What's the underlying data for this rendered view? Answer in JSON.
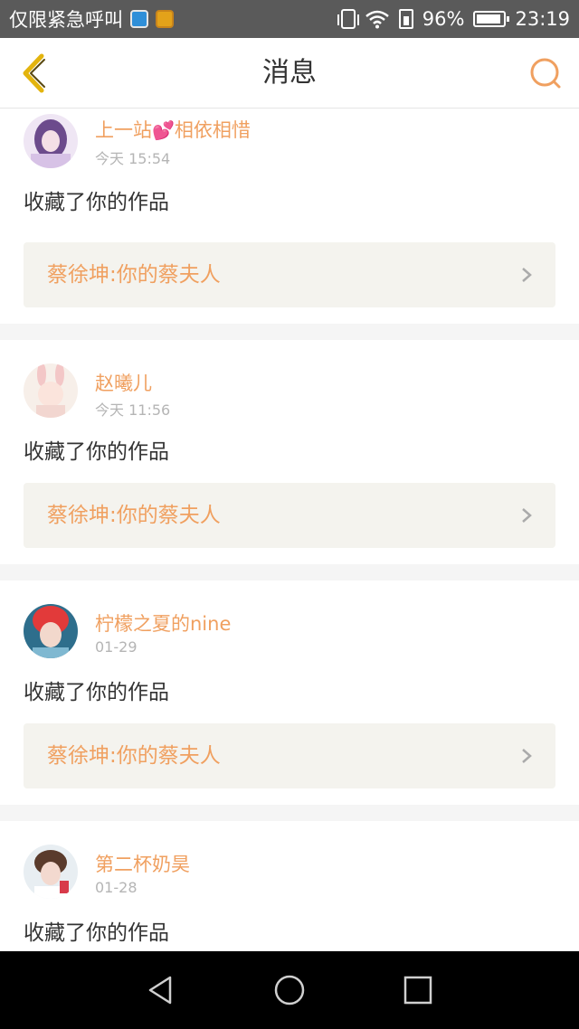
{
  "status_bar": {
    "carrier_text": "仅限紧急呼叫",
    "battery": "96%",
    "time": "23:19"
  },
  "header": {
    "title": "消息"
  },
  "messages": [
    {
      "username": "上一站",
      "username_suffix": "相依相惜",
      "time": "今天 15:54",
      "action": "收藏了你的作品",
      "work_title": "蔡徐坤:你的蔡夫人"
    },
    {
      "username": "赵曦儿",
      "time": "今天 11:56",
      "action": "收藏了你的作品",
      "work_title": "蔡徐坤:你的蔡夫人"
    },
    {
      "username": "柠檬之夏的nine",
      "time": "01-29",
      "action": "收藏了你的作品",
      "work_title": "蔡徐坤:你的蔡夫人"
    },
    {
      "username": "第二杯奶昊",
      "time": "01-28",
      "action": "收藏了你的作品",
      "work_title": ""
    }
  ],
  "colors": {
    "accent": "#f0a060",
    "back_icon": "#e3b40e",
    "card_link_bg": "#f4f3ee"
  },
  "icons": {
    "back": "chevron-left-icon",
    "search": "search-icon",
    "nav_back": "triangle-back-icon",
    "nav_home": "circle-home-icon",
    "nav_recents": "square-recents-icon"
  }
}
